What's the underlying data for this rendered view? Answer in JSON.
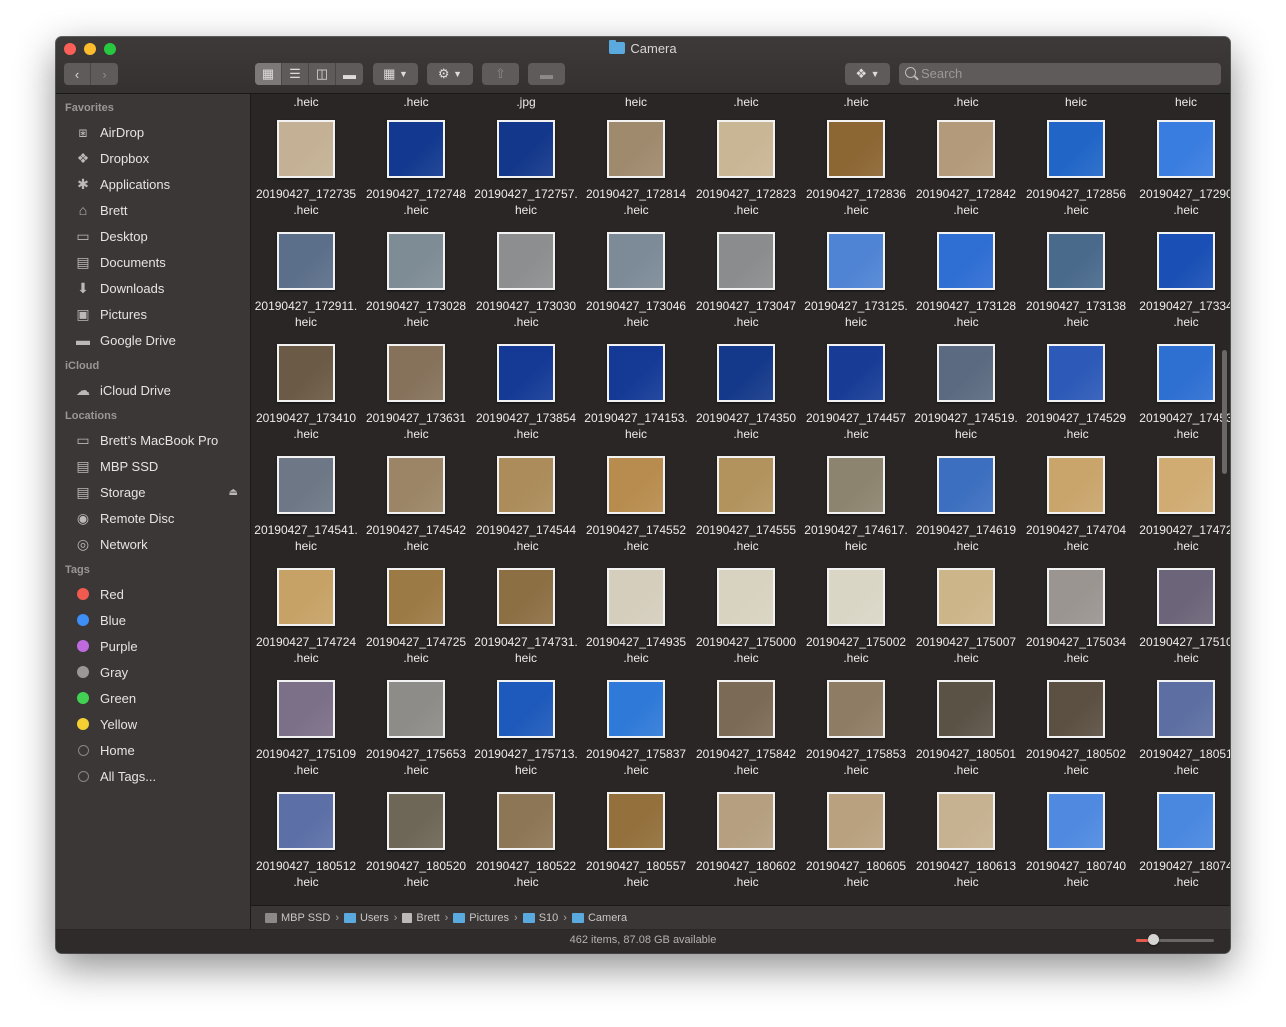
{
  "window": {
    "title": "Camera"
  },
  "toolbar": {
    "back_icon": "chevron-left-icon",
    "forward_icon": "chevron-right-icon",
    "view_modes": [
      "icon-view-icon",
      "list-view-icon",
      "column-view-icon",
      "gallery-view-icon"
    ],
    "active_view": "icon-view-icon",
    "search_placeholder": "Search"
  },
  "sidebar": {
    "favorites_header": "Favorites",
    "favorites": [
      {
        "label": "AirDrop",
        "icon": "airdrop-icon"
      },
      {
        "label": "Dropbox",
        "icon": "dropbox-icon"
      },
      {
        "label": "Applications",
        "icon": "applications-icon"
      },
      {
        "label": "Brett",
        "icon": "home-icon"
      },
      {
        "label": "Desktop",
        "icon": "desktop-icon"
      },
      {
        "label": "Documents",
        "icon": "documents-icon"
      },
      {
        "label": "Downloads",
        "icon": "downloads-icon"
      },
      {
        "label": "Pictures",
        "icon": "pictures-icon"
      },
      {
        "label": "Google Drive",
        "icon": "folder-icon"
      }
    ],
    "icloud_header": "iCloud",
    "icloud": [
      {
        "label": "iCloud Drive",
        "icon": "cloud-icon"
      }
    ],
    "locations_header": "Locations",
    "locations": [
      {
        "label": "Brett’s MacBook Pro",
        "icon": "laptop-icon"
      },
      {
        "label": "MBP SSD",
        "icon": "disk-icon"
      },
      {
        "label": "Storage",
        "icon": "external-disk-icon"
      },
      {
        "label": "Remote Disc",
        "icon": "disc-icon"
      },
      {
        "label": "Network",
        "icon": "network-icon"
      }
    ],
    "tags_header": "Tags",
    "tags": [
      {
        "label": "Red",
        "color": "#f05a4f"
      },
      {
        "label": "Blue",
        "color": "#3d8ef5"
      },
      {
        "label": "Purple",
        "color": "#c06ae0"
      },
      {
        "label": "Gray",
        "color": "#9a9796"
      },
      {
        "label": "Green",
        "color": "#42d152"
      },
      {
        "label": "Yellow",
        "color": "#f5d033"
      },
      {
        "label": "Home",
        "color": "none"
      },
      {
        "label": "All Tags...",
        "color": "none"
      }
    ]
  },
  "top_row_extensions": [
    ".heic",
    ".heic",
    ".jpg",
    "heic",
    ".heic",
    ".heic",
    ".heic",
    "heic",
    "heic"
  ],
  "files": [
    [
      [
        "20190427_172735",
        ".heic",
        "#c4b195"
      ],
      [
        "20190427_172748",
        ".heic",
        "#12398f"
      ],
      [
        "20190427_172757.",
        "heic",
        "#13378a"
      ],
      [
        "20190427_172814",
        ".heic",
        "#a08a6e"
      ],
      [
        "20190427_172823",
        ".heic",
        "#c9b695"
      ],
      [
        "20190427_172836",
        ".heic",
        "#8c6633"
      ],
      [
        "20190427_172842",
        ".heic",
        "#b39a7a"
      ],
      [
        "20190427_172856",
        ".heic",
        "#2166c7"
      ],
      [
        "20190427_17290",
        ".heic",
        "#3a7de0"
      ]
    ],
    [
      [
        "20190427_172911.",
        "heic",
        "#5c6f8a"
      ],
      [
        "20190427_173028",
        ".heic",
        "#7e8c95"
      ],
      [
        "20190427_173030",
        ".heic",
        "#8d8e8f"
      ],
      [
        "20190427_173046",
        ".heic",
        "#7d8b98"
      ],
      [
        "20190427_173047",
        ".heic",
        "#8a8c8d"
      ],
      [
        "20190427_173125.",
        "heic",
        "#4f84d4"
      ],
      [
        "20190427_173128",
        ".heic",
        "#2f6ed3"
      ],
      [
        "20190427_173138",
        ".heic",
        "#4a6a8c"
      ],
      [
        "20190427_17334",
        ".heic",
        "#1a50b5"
      ]
    ],
    [
      [
        "20190427_173410",
        ".heic",
        "#6b5a45"
      ],
      [
        "20190427_173631",
        ".heic",
        "#86725b"
      ],
      [
        "20190427_173854",
        ".heic",
        "#143a96"
      ],
      [
        "20190427_174153.",
        "heic",
        "#143a96"
      ],
      [
        "20190427_174350",
        ".heic",
        "#15398a"
      ],
      [
        "20190427_174457",
        ".heic",
        "#183c96"
      ],
      [
        "20190427_174519.",
        "heic",
        "#5b6a80"
      ],
      [
        "20190427_174529",
        ".heic",
        "#2d5ab8"
      ],
      [
        "20190427_17453",
        ".heic",
        "#2e6fd2"
      ]
    ],
    [
      [
        "20190427_174541.",
        "heic",
        "#6d7785"
      ],
      [
        "20190427_174542",
        ".heic",
        "#9b8566"
      ],
      [
        "20190427_174544",
        ".heic",
        "#ab8c5a"
      ],
      [
        "20190427_174552",
        ".heic",
        "#b88c4e"
      ],
      [
        "20190427_174555",
        ".heic",
        "#b2935e"
      ],
      [
        "20190427_174617.",
        "heic",
        "#8d846f"
      ],
      [
        "20190427_174619",
        ".heic",
        "#3d6fc0"
      ],
      [
        "20190427_174704",
        ".heic",
        "#c9a56c"
      ],
      [
        "20190427_17472",
        ".heic",
        "#d0ac73"
      ]
    ],
    [
      [
        "20190427_174724",
        ".heic",
        "#c6a266"
      ],
      [
        "20190427_174725",
        ".heic",
        "#9c7a45"
      ],
      [
        "20190427_174731.",
        "heic",
        "#8d6f44"
      ],
      [
        "20190427_174935",
        ".heic",
        "#d5cebd"
      ],
      [
        "20190427_175000",
        ".heic",
        "#d8d3c0"
      ],
      [
        "20190427_175002",
        ".heic",
        "#d9d6c6"
      ],
      [
        "20190427_175007",
        ".heic",
        "#cdb58a"
      ],
      [
        "20190427_175034",
        ".heic",
        "#9a9590"
      ],
      [
        "20190427_17510",
        ".heic",
        "#6c6478"
      ]
    ],
    [
      [
        "20190427_175109",
        ".heic",
        "#7c6f88"
      ],
      [
        "20190427_175653",
        ".heic",
        "#8d8c88"
      ],
      [
        "20190427_175713.",
        "heic",
        "#1e5abb"
      ],
      [
        "20190427_175837",
        ".heic",
        "#2f7ad8"
      ],
      [
        "20190427_175842",
        ".heic",
        "#7b6a55"
      ],
      [
        "20190427_175853",
        ".heic",
        "#8f7c64"
      ],
      [
        "20190427_180501",
        ".heic",
        "#5a5245"
      ],
      [
        "20190427_180502",
        ".heic",
        "#5b5042"
      ],
      [
        "20190427_18051",
        ".heic",
        "#5d6fa2"
      ]
    ],
    [
      [
        "20190427_180512",
        ".heic",
        "#5c6fa6"
      ],
      [
        "20190427_180520",
        ".heic",
        "#6e6656"
      ],
      [
        "20190427_180522",
        ".heic",
        "#8d7655"
      ],
      [
        "20190427_180557",
        ".heic",
        "#93703c"
      ],
      [
        "20190427_180602",
        ".heic",
        "#b59f80"
      ],
      [
        "20190427_180605",
        ".heic",
        "#b9a17f"
      ],
      [
        "20190427_180613",
        ".heic",
        "#c6b291"
      ],
      [
        "20190427_180740",
        ".heic",
        "#4f8ae0"
      ],
      [
        "20190427_18074",
        ".heic",
        "#4a88e0"
      ]
    ]
  ],
  "pathbar": [
    {
      "label": "MBP SSD",
      "icon": "disk-icon"
    },
    {
      "label": "Users",
      "icon": "folder-icon"
    },
    {
      "label": "Brett",
      "icon": "home-icon"
    },
    {
      "label": "Pictures",
      "icon": "folder-icon"
    },
    {
      "label": "S10",
      "icon": "folder-icon"
    },
    {
      "label": "Camera",
      "icon": "folder-icon"
    }
  ],
  "status": {
    "text": "462 items, 87.08 GB available",
    "zoom_level": 0.22
  }
}
